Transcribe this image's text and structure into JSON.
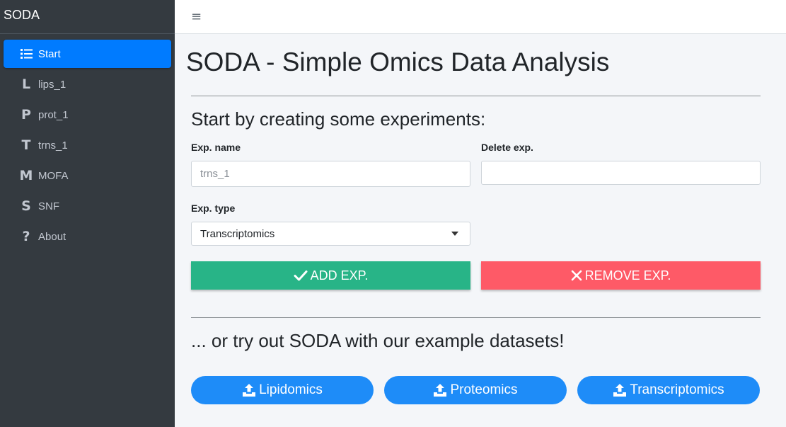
{
  "sidebar": {
    "brand": "SODA",
    "items": [
      {
        "icon": "list-icon",
        "glyph": "",
        "label": "Start",
        "active": true
      },
      {
        "icon": "letter-l-icon",
        "glyph": "L",
        "label": "lips_1",
        "active": false
      },
      {
        "icon": "letter-p-icon",
        "glyph": "P",
        "label": "prot_1",
        "active": false
      },
      {
        "icon": "letter-t-icon",
        "glyph": "T",
        "label": "trns_1",
        "active": false
      },
      {
        "icon": "letter-m-icon",
        "glyph": "M",
        "label": "MOFA",
        "active": false
      },
      {
        "icon": "letter-s-icon",
        "glyph": "S",
        "label": "SNF",
        "active": false
      },
      {
        "icon": "question-icon",
        "glyph": "?",
        "label": "About",
        "active": false
      }
    ]
  },
  "header": {
    "menu_glyph": "≡"
  },
  "main": {
    "title": "SODA - Simple Omics Data Analysis",
    "create_heading": "Start by creating some experiments:",
    "exp_name_label": "Exp. name",
    "exp_name_placeholder": "trns_1",
    "delete_label": "Delete exp.",
    "delete_value": "",
    "exp_type_label": "Exp. type",
    "exp_type_selected": "Transcriptomics",
    "add_button": "ADD EXP.",
    "remove_button": "REMOVE EXP.",
    "example_heading": "... or try out SODA with our example datasets!",
    "example_buttons": [
      "Lipidomics",
      "Proteomics",
      "Transcriptomics"
    ]
  },
  "colors": {
    "sidebar_bg": "#343a40",
    "active_blue": "#007bff",
    "add_green": "#28b487",
    "remove_red": "#fe5a67",
    "example_blue": "#1e8cf8"
  }
}
